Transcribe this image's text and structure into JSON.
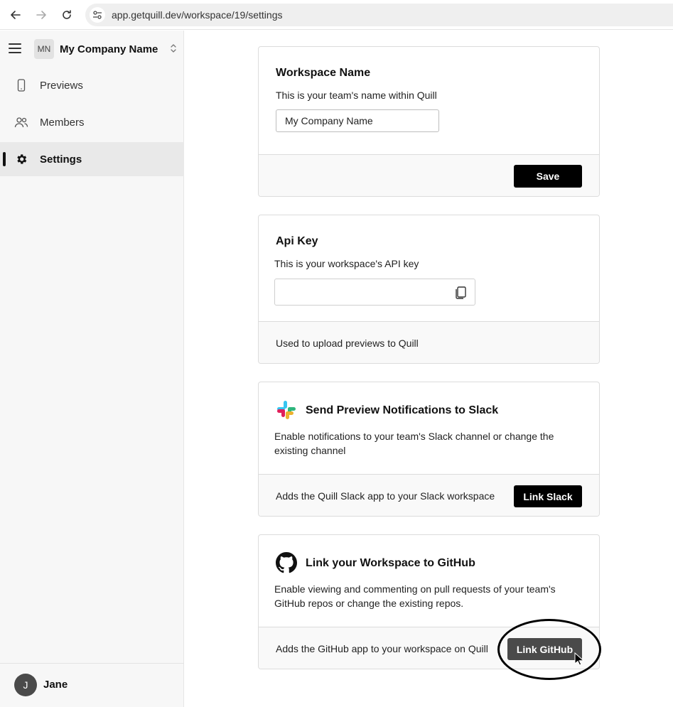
{
  "browser": {
    "url": "app.getquill.dev/workspace/19/settings"
  },
  "sidebar": {
    "workspace_initials": "MN",
    "workspace_name": "My Company Name",
    "items": [
      {
        "label": "Previews",
        "icon": "phone-icon"
      },
      {
        "label": "Members",
        "icon": "users-icon"
      },
      {
        "label": "Settings",
        "icon": "gear-icon",
        "active": true
      }
    ],
    "user": {
      "initial": "J",
      "name": "Jane"
    }
  },
  "cards": {
    "workspace_name": {
      "title": "Workspace Name",
      "description": "This is your team's name within Quill",
      "input_value": "My Company Name",
      "save_label": "Save"
    },
    "api_key": {
      "title": "Api Key",
      "description": "This is your workspace's API key",
      "input_value": "",
      "footer_text": "Used to upload previews to Quill"
    },
    "slack": {
      "title": "Send Preview Notifications to Slack",
      "description": "Enable notifications to your team's Slack channel or change the existing channel",
      "footer_text": "Adds the Quill Slack app to your Slack workspace",
      "button_label": "Link Slack"
    },
    "github": {
      "title": "Link your Workspace to GitHub",
      "description": "Enable viewing and commenting on pull requests of your team's GitHub repos or change the existing repos.",
      "footer_text": "Adds the GitHub app to your workspace on Quill",
      "button_label": "Link GitHub"
    }
  },
  "colors": {
    "primary_button": "#000000",
    "hover_button": "#4a4a4a",
    "sidebar_bg": "#f7f7f7"
  }
}
